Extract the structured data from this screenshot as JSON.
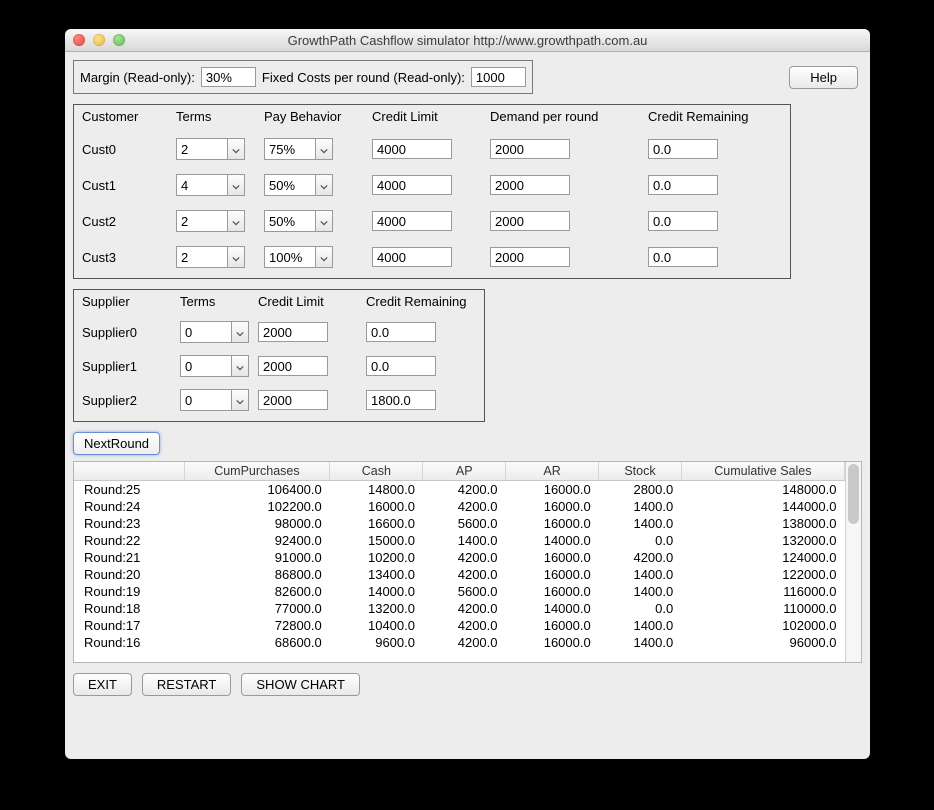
{
  "window": {
    "title": "GrowthPath Cashflow simulator http://www.growthpath.com.au"
  },
  "top": {
    "margin_label": "Margin (Read-only):",
    "margin_value": "30%",
    "fixed_label": "Fixed Costs per round (Read-only):",
    "fixed_value": "1000",
    "help_label": "Help"
  },
  "customers": {
    "headers": {
      "customer": "Customer",
      "terms": "Terms",
      "pay": "Pay Behavior",
      "credit_limit": "Credit Limit",
      "demand": "Demand per round",
      "credit_remaining": "Credit Remaining"
    },
    "rows": [
      {
        "name": "Cust0",
        "terms": "2",
        "pay": "75%",
        "credit_limit": "4000",
        "demand": "2000",
        "credit_remaining": "0.0"
      },
      {
        "name": "Cust1",
        "terms": "4",
        "pay": "50%",
        "credit_limit": "4000",
        "demand": "2000",
        "credit_remaining": "0.0"
      },
      {
        "name": "Cust2",
        "terms": "2",
        "pay": "50%",
        "credit_limit": "4000",
        "demand": "2000",
        "credit_remaining": "0.0"
      },
      {
        "name": "Cust3",
        "terms": "2",
        "pay": "100%",
        "credit_limit": "4000",
        "demand": "2000",
        "credit_remaining": "0.0"
      }
    ]
  },
  "suppliers": {
    "headers": {
      "supplier": "Supplier",
      "terms": "Terms",
      "credit_limit": "Credit Limit",
      "credit_remaining": "Credit Remaining"
    },
    "rows": [
      {
        "name": "Supplier0",
        "terms": "0",
        "credit_limit": "2000",
        "credit_remaining": "0.0"
      },
      {
        "name": "Supplier1",
        "terms": "0",
        "credit_limit": "2000",
        "credit_remaining": "0.0"
      },
      {
        "name": "Supplier2",
        "terms": "0",
        "credit_limit": "2000",
        "credit_remaining": "1800.0"
      }
    ]
  },
  "next_round": "NextRound",
  "table": {
    "headers": [
      "",
      "CumPurchases",
      "Cash",
      "AP",
      "AR",
      "Stock",
      "Cumulative Sales"
    ],
    "rows": [
      [
        "Round:25",
        "106400.0",
        "14800.0",
        "4200.0",
        "16000.0",
        "2800.0",
        "148000.0"
      ],
      [
        "Round:24",
        "102200.0",
        "16000.0",
        "4200.0",
        "16000.0",
        "1400.0",
        "144000.0"
      ],
      [
        "Round:23",
        "98000.0",
        "16600.0",
        "5600.0",
        "16000.0",
        "1400.0",
        "138000.0"
      ],
      [
        "Round:22",
        "92400.0",
        "15000.0",
        "1400.0",
        "14000.0",
        "0.0",
        "132000.0"
      ],
      [
        "Round:21",
        "91000.0",
        "10200.0",
        "4200.0",
        "16000.0",
        "4200.0",
        "124000.0"
      ],
      [
        "Round:20",
        "86800.0",
        "13400.0",
        "4200.0",
        "16000.0",
        "1400.0",
        "122000.0"
      ],
      [
        "Round:19",
        "82600.0",
        "14000.0",
        "5600.0",
        "16000.0",
        "1400.0",
        "116000.0"
      ],
      [
        "Round:18",
        "77000.0",
        "13200.0",
        "4200.0",
        "14000.0",
        "0.0",
        "110000.0"
      ],
      [
        "Round:17",
        "72800.0",
        "10400.0",
        "4200.0",
        "16000.0",
        "1400.0",
        "102000.0"
      ],
      [
        "Round:16",
        "68600.0",
        "9600.0",
        "4200.0",
        "16000.0",
        "1400.0",
        "96000.0"
      ]
    ]
  },
  "buttons": {
    "exit": "EXIT",
    "restart": "RESTART",
    "show_chart": "SHOW CHART"
  }
}
